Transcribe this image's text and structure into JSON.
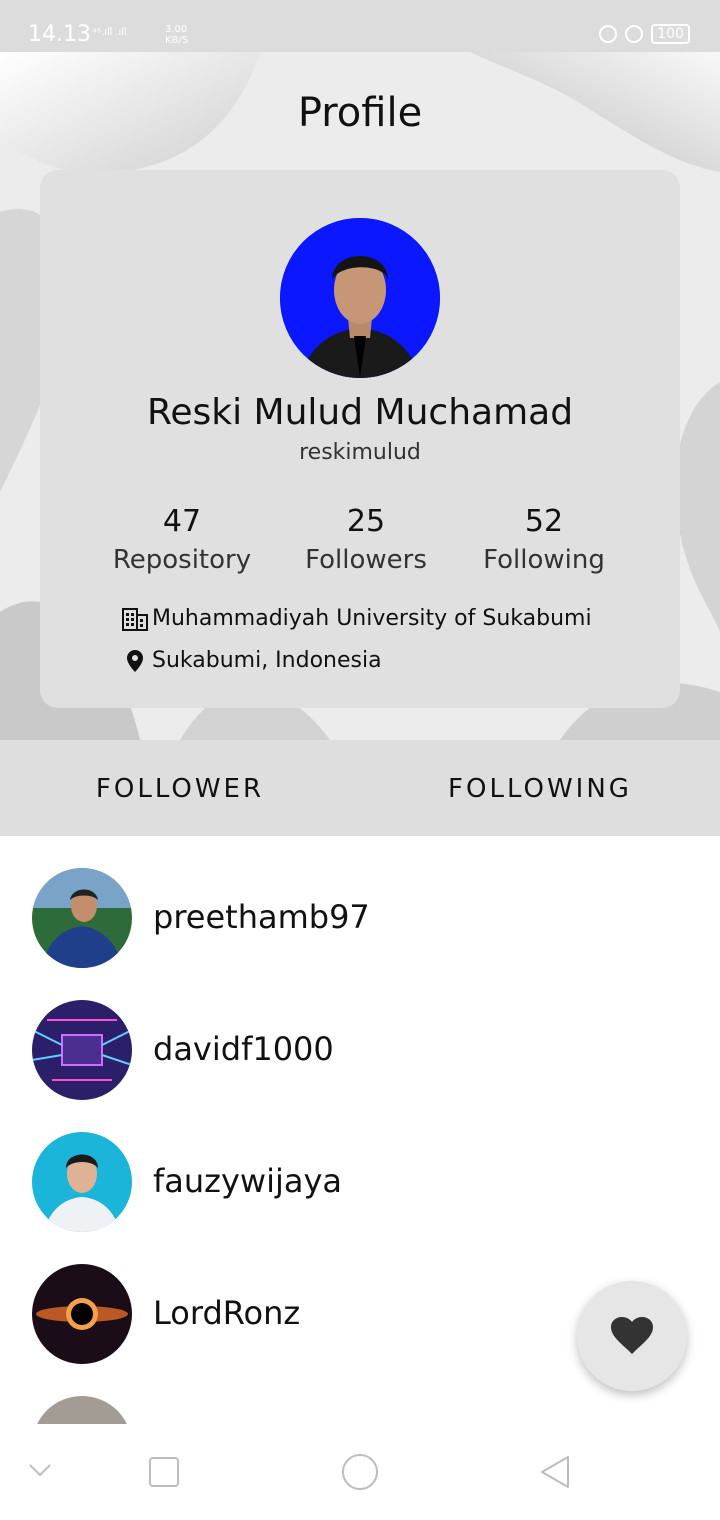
{
  "status_bar": {
    "time": "14.13",
    "network": "⁴⁶.ıll .ıll",
    "speed_value": "3.00",
    "speed_unit": "KB/S",
    "battery": "100"
  },
  "header": {
    "title": "Profile"
  },
  "profile": {
    "name": "Reski Mulud Muchamad",
    "username": "reskimulud",
    "stats": [
      {
        "value": "47",
        "label": "Repository"
      },
      {
        "value": "25",
        "label": "Followers"
      },
      {
        "value": "52",
        "label": "Following"
      }
    ],
    "company": "Muhammadiyah University of Sukabumi",
    "location": "Sukabumi, Indonesia"
  },
  "tabs": [
    {
      "label": "FOLLOWER",
      "active": true
    },
    {
      "label": "FOLLOWING",
      "active": false
    }
  ],
  "users": [
    {
      "username": "preethamb97"
    },
    {
      "username": "davidf1000"
    },
    {
      "username": "fauzywijaya"
    },
    {
      "username": "LordRonz"
    }
  ],
  "colors": {
    "avatar_bg": "#0a17ff",
    "card_bg": "#e0e0e0",
    "tabs_bg": "#dedede"
  },
  "icons": {
    "fab": "heart-icon",
    "company": "building-icon",
    "location": "map-pin-icon"
  }
}
